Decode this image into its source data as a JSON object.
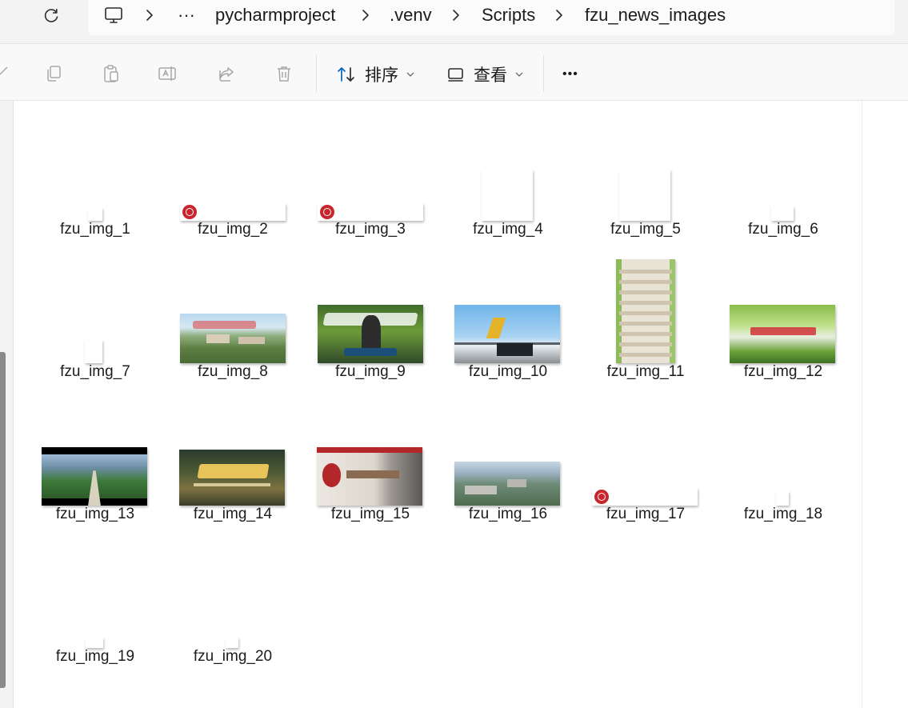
{
  "address_bar": {
    "path": [
      "pycharmproject",
      ".venv",
      "Scripts",
      "fzu_news_images"
    ],
    "overflow_label": "···"
  },
  "toolbar": {
    "sort_label": "排序",
    "view_label": "查看",
    "more_label": "•••"
  },
  "files": [
    {
      "name": "fzu_img_1",
      "thumb": "blank"
    },
    {
      "name": "fzu_img_2",
      "thumb": "banner"
    },
    {
      "name": "fzu_img_3",
      "thumb": "banner"
    },
    {
      "name": "fzu_img_4",
      "thumb": "blank"
    },
    {
      "name": "fzu_img_5",
      "thumb": "blank"
    },
    {
      "name": "fzu_img_6",
      "thumb": "blank"
    },
    {
      "name": "fzu_img_7",
      "thumb": "blank"
    },
    {
      "name": "fzu_img_8",
      "thumb": "campus"
    },
    {
      "name": "fzu_img_9",
      "thumb": "game"
    },
    {
      "name": "fzu_img_10",
      "thumb": "sky"
    },
    {
      "name": "fzu_img_11",
      "thumb": "tower"
    },
    {
      "name": "fzu_img_12",
      "thumb": "leaf"
    },
    {
      "name": "fzu_img_13",
      "thumb": "cinema"
    },
    {
      "name": "fzu_img_14",
      "thumb": "gold"
    },
    {
      "name": "fzu_img_15",
      "thumb": "wall"
    },
    {
      "name": "fzu_img_16",
      "thumb": "aerial"
    },
    {
      "name": "fzu_img_17",
      "thumb": "banner"
    },
    {
      "name": "fzu_img_18",
      "thumb": "blank"
    },
    {
      "name": "fzu_img_19",
      "thumb": "blank"
    },
    {
      "name": "fzu_img_20",
      "thumb": "blank"
    }
  ],
  "colors": {
    "accent": "#0067c0",
    "seal_red": "#c8262c"
  }
}
